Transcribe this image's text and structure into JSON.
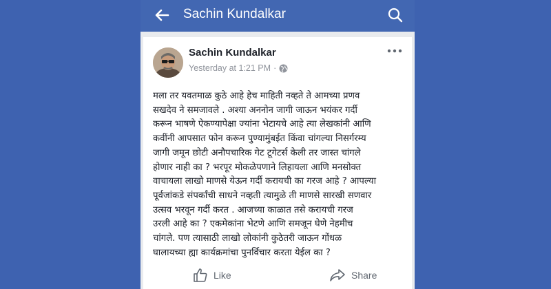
{
  "appbar": {
    "title": "Sachin Kundalkar",
    "back_icon": "back-arrow-icon",
    "search_icon": "search-icon"
  },
  "post": {
    "author": "Sachin Kundalkar",
    "time": "Yesterday at 1:21 PM",
    "privacy_icon": "globe-icon",
    "more_icon": "more-options-icon",
    "text": "मला तर यवतमाळ कुठे आहे हेच माहिती नव्हते ते आमच्या प्रणव\nसखदेव  ने समजावले . अश्या अननोन जागी जाऊन भयंकर गर्दी\nकरून भाषणे ऐकण्यापेक्षा ज्यांना भेटायचे आहे त्या लेखकांनी आणि\nकवींनी आपसात फोन करून पुण्यामुंबईत किंवा चांगल्या निसर्गरम्य\nजागी जमून छोटी अनौपचारिक गेट टूगेटर्स  केली तर जास्त चांगले\nहोणार नाही का ?  भरपूर मोकळेपणाने लिहायला आणि मनसोक्त\nवाचायला लाखो माणसे येऊन गर्दी करायची का गरज आहे ? आपल्या\nपूर्वजांकडे संपर्कांची साधने नव्हती त्यामुळे ती माणसे सारखी सणवार\nउत्सव भरवून  गर्दी करत . आजच्या  काळात  तसे करायची गरज\nउरली आहे का ? एकमेकांना  भेटणे आणि समजून घेणे नेहमीच\nचांगले.  पण त्यासाठी लाखो लोकांनी  कुठेतरी जाऊन गोंधळ\nघालायच्या ह्या कार्यक्रमांचा पुनर्विचार करता येईल का ?"
  },
  "actions": {
    "like_label": "Like",
    "like_icon": "thumbs-up-icon",
    "share_label": "Share",
    "share_icon": "share-arrow-icon"
  },
  "colors": {
    "background": "#3e62b0",
    "appbar": "#4267b2",
    "feed": "#e9ebee",
    "text": "#1d2129",
    "muted": "#90949c"
  }
}
